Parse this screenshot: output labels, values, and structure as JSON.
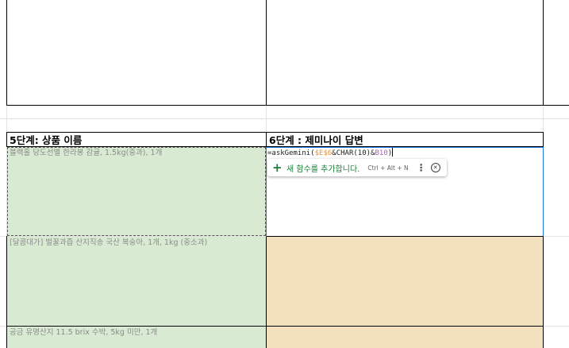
{
  "header_step5": "5단계: 상품 이름",
  "header_step6": "6단계 : 제미나이 답변",
  "formula": {
    "prefix": "=askGemini(",
    "ref1": "$E$6",
    "mid": "&CHAR(10)&",
    "ref2": "B10",
    "suffix": ")"
  },
  "suggestion": {
    "icon": "plus-icon",
    "label": "새 함수를 추가합니다.",
    "shortcut": "Ctrl + Alt + N",
    "more_icon": "more-vert-icon",
    "close_icon": "close-circle-icon"
  },
  "products": [
    "블랙홀 당도선별 한라봉 감귤, 1.5kg(중과), 1개",
    "[달콤대가] 벌꿀과즙 산지직송 국산 복숭아, 1개, 1kg (중소과)",
    "공금 유명산지 11.5 brix 수박, 5kg 미만, 1개"
  ],
  "colors": {
    "green_fill": "#d9ead3",
    "orange_fill": "#f3e0bd",
    "active_border": "#1a73e8",
    "ref1_color": "#e69138",
    "ref2_color": "#9e69af"
  }
}
